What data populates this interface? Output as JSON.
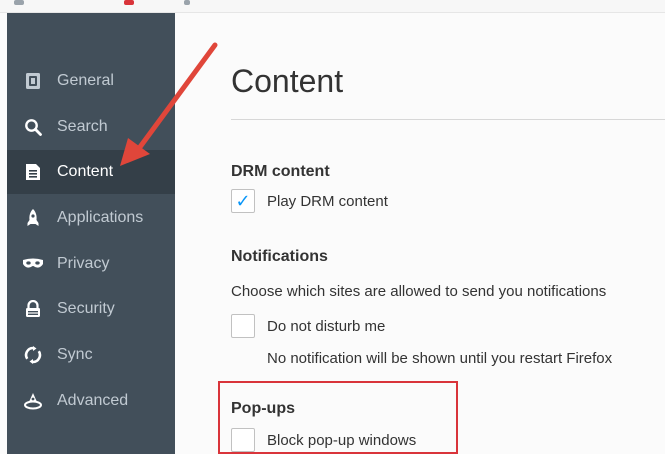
{
  "sidebar": {
    "items": [
      {
        "label": "General",
        "icon": "general-icon",
        "selected": false
      },
      {
        "label": "Search",
        "icon": "search-icon",
        "selected": false
      },
      {
        "label": "Content",
        "icon": "content-icon",
        "selected": true
      },
      {
        "label": "Applications",
        "icon": "applications-icon",
        "selected": false
      },
      {
        "label": "Privacy",
        "icon": "privacy-mask-icon",
        "selected": false
      },
      {
        "label": "Security",
        "icon": "security-lock-icon",
        "selected": false
      },
      {
        "label": "Sync",
        "icon": "sync-icon",
        "selected": false
      },
      {
        "label": "Advanced",
        "icon": "advanced-icon",
        "selected": false
      }
    ]
  },
  "main": {
    "title": "Content",
    "drm": {
      "heading": "DRM content",
      "checkbox_label": "Play DRM content",
      "checked": true
    },
    "notifications": {
      "heading": "Notifications",
      "description": "Choose which sites are allowed to send you notifications",
      "checkbox_label": "Do not disturb me",
      "checked": false,
      "note": "No notification will be shown until you restart Firefox"
    },
    "popups": {
      "heading": "Pop-ups",
      "checkbox_label": "Block pop-up windows",
      "checked": false
    }
  },
  "colors": {
    "sidebar_bg": "#424f5a",
    "sidebar_selected_bg": "#343f48",
    "check_blue": "#0996f8",
    "annotation_red": "#d9343a"
  },
  "annotations": {
    "arrow_color": "#e0463a",
    "highlight_color": "#d9343a"
  }
}
